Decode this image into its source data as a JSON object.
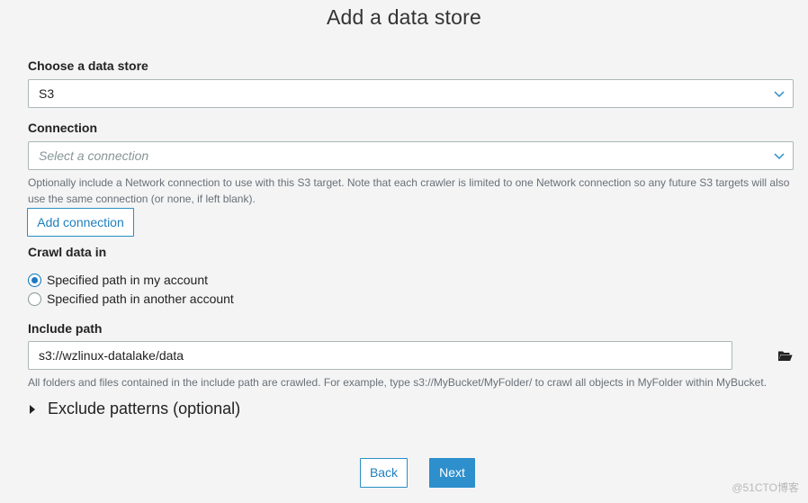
{
  "page": {
    "title": "Add a data store"
  },
  "data_store": {
    "label": "Choose a data store",
    "value": "S3"
  },
  "connection": {
    "label": "Connection",
    "placeholder": "Select a connection",
    "help": "Optionally include a Network connection to use with this S3 target. Note that each crawler is limited to one Network connection so any future S3 targets will also use the same connection (or none, if left blank).",
    "add_button": "Add connection"
  },
  "crawl": {
    "label": "Crawl data in",
    "options": [
      {
        "label": "Specified path in my account",
        "checked": true
      },
      {
        "label": "Specified path in another account",
        "checked": false
      }
    ]
  },
  "include_path": {
    "label": "Include path",
    "value": "s3://wzlinux-datalake/data",
    "help": "All folders and files contained in the include path are crawled. For example, type s3://MyBucket/MyFolder/ to crawl all objects in MyFolder within MyBucket."
  },
  "exclude": {
    "label": "Exclude patterns (optional)"
  },
  "footer": {
    "back": "Back",
    "next": "Next"
  },
  "watermark": "@51CTO博客",
  "colors": {
    "primary": "#2d8fcc",
    "link": "#1e7fbd",
    "border": "#aab7b8"
  },
  "icons": {
    "select_arrow": "chevron-down-icon",
    "browse": "folder-open-icon",
    "expand": "caret-right-icon"
  }
}
